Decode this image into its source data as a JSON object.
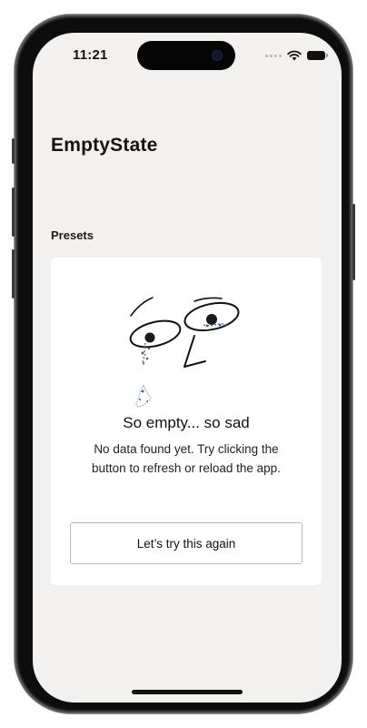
{
  "status_bar": {
    "time": "11:21",
    "icons": [
      "signal-dots-icon",
      "wifi-icon",
      "battery-icon"
    ]
  },
  "header": {
    "title": "EmptyState"
  },
  "section": {
    "label": "Presets"
  },
  "empty_state": {
    "illustration": "sad-face-illustration",
    "title": "So empty... so sad",
    "description": "No data found yet. Try clicking the button to refresh or reload the app.",
    "button_label": "Let’s try this again"
  },
  "colors": {
    "screen_background": "#f2f1ef",
    "card_background": "#ffffff",
    "text": "#111111",
    "button_border": "#b9b9b9"
  }
}
